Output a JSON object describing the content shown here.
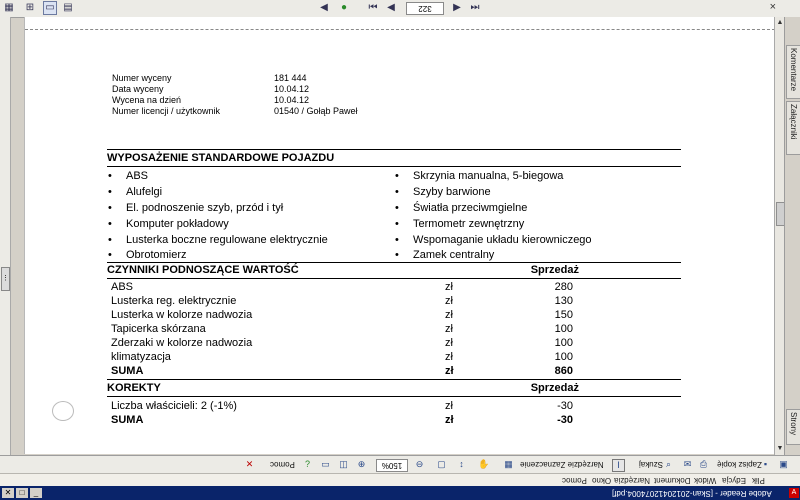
{
  "window": {
    "title": "Adobe Reader - [Skan-20120412074004.pdf]",
    "menu": [
      "Plik",
      "Edycja",
      "Widok",
      "Dokument",
      "Narzędzia",
      "Okno",
      "Pomoc"
    ]
  },
  "top_toolbar": {
    "page_number": "322",
    "close_glyph": "×"
  },
  "bottom_toolbar": {
    "save_copy": "Zapisz kopię",
    "search": "Szukaj",
    "select_tool": "Narzędzie Zaznaczenie",
    "zoom": "150%",
    "help": "Pomoc"
  },
  "right_panel": {
    "tabs": [
      "Komentarze",
      "Załączniki",
      "Strony"
    ]
  },
  "document": {
    "meta": [
      {
        "label": "Numer wyceny",
        "value": "181 444"
      },
      {
        "label": "Data wyceny",
        "value": "10.04.12"
      },
      {
        "label": "Wycena na dzień",
        "value": "10.04.12"
      },
      {
        "label": "Numer licencji / użytkownik",
        "value": "01540 / Gołąb Paweł"
      }
    ],
    "equipment": {
      "title": "WYPOSAŻENIE STANDARDOWE POJAZDU",
      "left": [
        "ABS",
        "Alufelgi",
        "El. podnoszenie szyb, przód i tył",
        "Komputer pokładowy",
        "Lusterka boczne regulowane elektrycznie",
        "Obrotomierz"
      ],
      "right": [
        "Skrzynia manualna, 5-biegowa",
        "Szyby barwione",
        "Światła przeciwmgielne",
        "Termometr zewnętrzny",
        "Wspomaganie układu kierowniczego",
        "Zamek centralny"
      ]
    },
    "value_factors": {
      "title": "CZYNNIKI PODNOSZĄCE WARTOŚĆ",
      "column": "Sprzedaż",
      "rows": [
        {
          "name": "ABS",
          "currency": "zł",
          "value": "280"
        },
        {
          "name": "Lusterka reg. elektrycznie",
          "currency": "zł",
          "value": "130"
        },
        {
          "name": "Lusterka w kolorze nadwozia",
          "currency": "zł",
          "value": "150"
        },
        {
          "name": "Tapicerka skórzana",
          "currency": "zł",
          "value": "100"
        },
        {
          "name": "Zderzaki w kolorze nadwozia",
          "currency": "zł",
          "value": "100"
        },
        {
          "name": "klimatyzacja",
          "currency": "zł",
          "value": "100"
        }
      ],
      "sum": {
        "name": "SUMA",
        "currency": "zł",
        "value": "860"
      }
    },
    "corrections": {
      "title": "KOREKTY",
      "column": "Sprzedaż",
      "rows": [
        {
          "name": "Liczba właścicieli: 2 (-1%)",
          "currency": "zł",
          "value": "-30"
        }
      ],
      "sum": {
        "name": "SUMA",
        "currency": "zł",
        "value": "-30"
      }
    }
  }
}
